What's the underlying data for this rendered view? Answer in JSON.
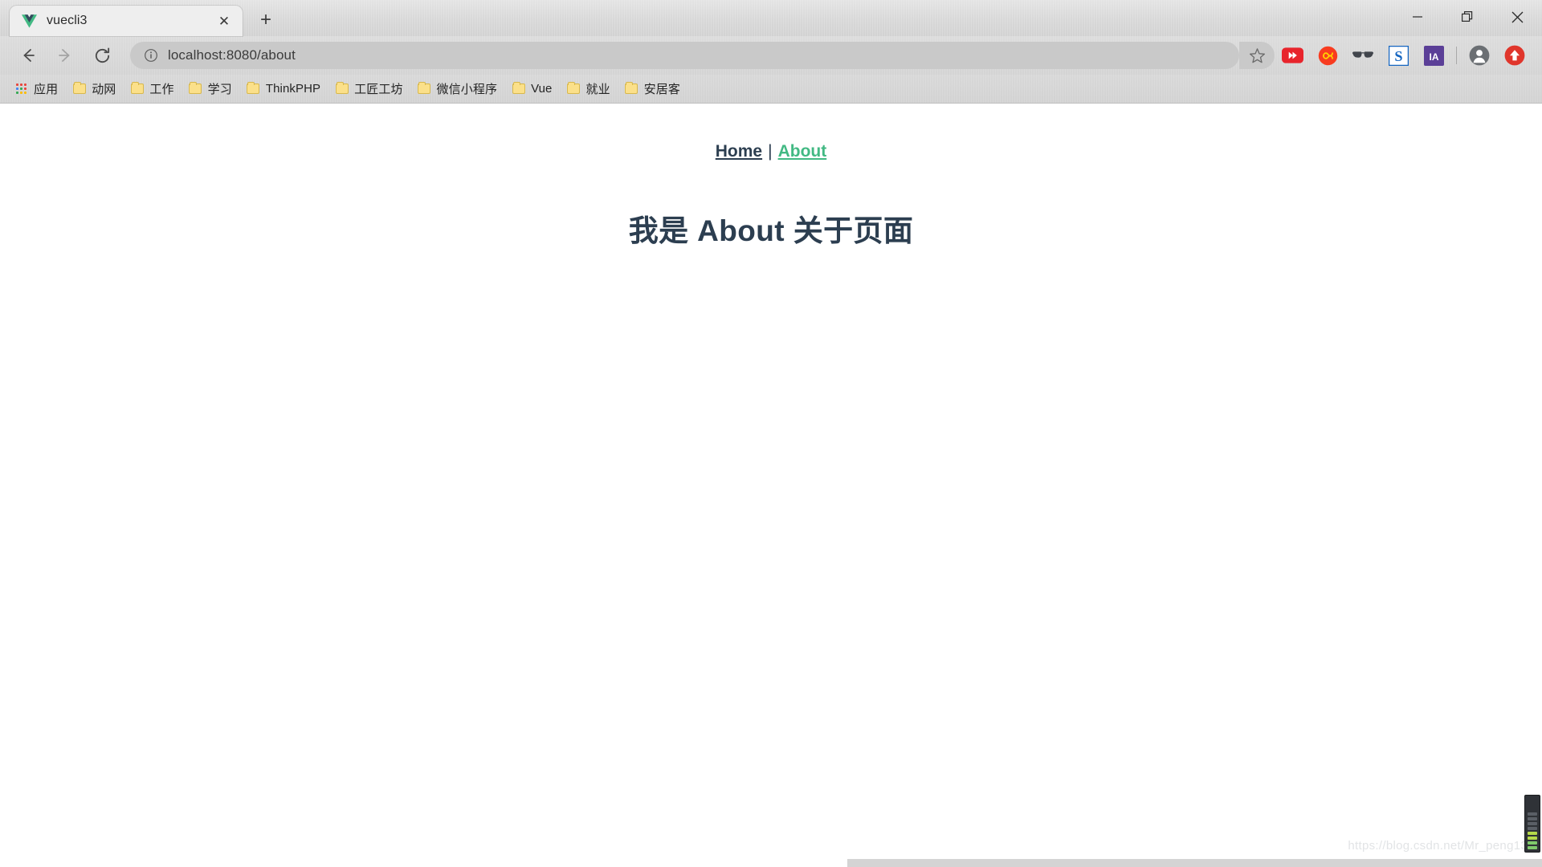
{
  "window": {
    "controls": [
      {
        "name": "minimize",
        "glyph": "—"
      },
      {
        "name": "restore",
        "glyph": "❐"
      },
      {
        "name": "close",
        "glyph": "✕"
      }
    ]
  },
  "tabstrip": {
    "tab": {
      "title": "vuecli3",
      "favicon": "vue-logo-icon",
      "close_glyph": "✕"
    },
    "new_tab_glyph": "+",
    "new_tab_name": "new-tab-button"
  },
  "toolbar": {
    "back_glyph": "←",
    "forward_glyph": "→",
    "reload_glyph": "↻",
    "info_glyph": "ⓘ",
    "url_scheme_host": "localhost:8080",
    "url_path": "/about",
    "url_full": "localhost:8080/about",
    "star_glyph": "☆",
    "extensions": [
      {
        "name": "youtube-extension-icon",
        "label": "▶▶",
        "color": "#e8242c"
      },
      {
        "name": "infinity-extension-icon",
        "label": "∞",
        "color": "#f83c20"
      },
      {
        "name": "sunglasses-extension-icon",
        "label": "◐◑",
        "color": "#6c7480"
      },
      {
        "name": "sogou-extension-icon",
        "label": "S",
        "color": "#1565c0"
      },
      {
        "name": "ia-extension-icon",
        "label": "IA",
        "color": "#5b3f97"
      }
    ],
    "profile_name": "profile-avatar",
    "update_name": "update-button",
    "update_glyph": "⬆"
  },
  "bookmarks": {
    "apps_label": "应用",
    "items": [
      {
        "label": "动网",
        "icon": "folder-icon"
      },
      {
        "label": "工作",
        "icon": "folder-icon"
      },
      {
        "label": "学习",
        "icon": "folder-icon"
      },
      {
        "label": "ThinkPHP",
        "icon": "folder-icon"
      },
      {
        "label": "工匠工坊",
        "icon": "folder-icon"
      },
      {
        "label": "微信小程序",
        "icon": "folder-icon"
      },
      {
        "label": "Vue",
        "icon": "folder-icon"
      },
      {
        "label": "就业",
        "icon": "folder-icon"
      },
      {
        "label": "安居客",
        "icon": "folder-icon"
      }
    ]
  },
  "page": {
    "nav": {
      "home_label": "Home",
      "separator": "|",
      "about_label": "About"
    },
    "heading": "我是 About 关于页面",
    "watermark": "https://blog.csdn.net/Mr_peng13"
  },
  "colors": {
    "vue_green": "#42b983",
    "vue_navy": "#35495e",
    "heading_navy": "#2c3e50",
    "chrome_grey": "#d4d4d4",
    "omnibox_grey": "#c9c9c9"
  }
}
